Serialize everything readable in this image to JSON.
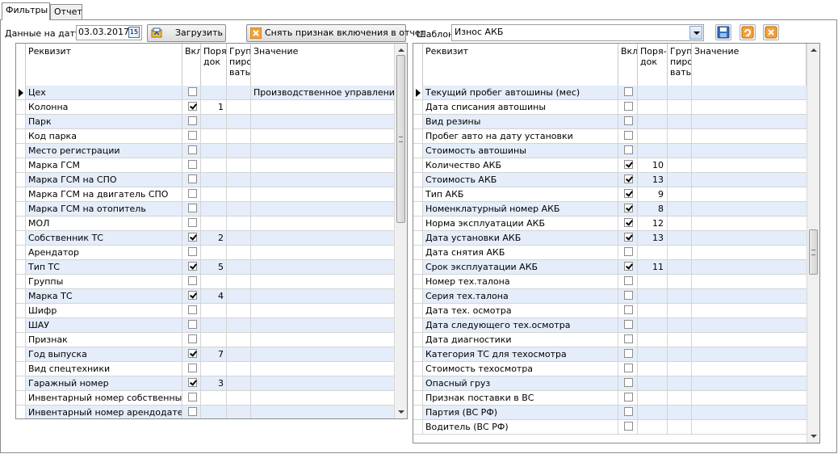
{
  "tabs": [
    {
      "label": "Фильтры",
      "active": true
    },
    {
      "label": "Отчет",
      "active": false
    }
  ],
  "toolbar": {
    "date_label": "Данные на дату:",
    "date_value": "03.03.2017",
    "load_label": "Загрузить",
    "unmark_label": "Снять признак включения в отчет",
    "template_label": "Шаблон",
    "template_value": "Износ АКБ"
  },
  "icons": {
    "calendar": "calendar-icon",
    "load": "load-icon",
    "unmark": "clear-x-icon",
    "save": "floppy-disk-icon",
    "edit": "edit-icon",
    "delete": "delete-x-icon"
  },
  "colors": {
    "row_alt": "#e4edf9",
    "accent_orange": "#f2a23a",
    "save_blue": "#2f6fc1"
  },
  "left_grid": {
    "columns": [
      "Реквизит",
      "Вкл",
      "Поря-\nдок",
      "Груп\nпиро\nвать",
      "Значение"
    ],
    "rows": [
      {
        "name": "Цех",
        "checked": false,
        "order": "",
        "value": "Производственное управление \"Т",
        "current": true
      },
      {
        "name": "Колонна",
        "checked": true,
        "order": "1",
        "value": ""
      },
      {
        "name": "Парк",
        "checked": false,
        "order": "",
        "value": ""
      },
      {
        "name": "Код парка",
        "checked": false,
        "order": "",
        "value": ""
      },
      {
        "name": "Место регистрации",
        "checked": false,
        "order": "",
        "value": ""
      },
      {
        "name": "Марка ГСМ",
        "checked": false,
        "order": "",
        "value": ""
      },
      {
        "name": "Марка ГСМ на СПО",
        "checked": false,
        "order": "",
        "value": ""
      },
      {
        "name": "Марка ГСМ на двигатель СПО",
        "checked": false,
        "order": "",
        "value": ""
      },
      {
        "name": "Марка ГСМ на отопитель",
        "checked": false,
        "order": "",
        "value": ""
      },
      {
        "name": "МОЛ",
        "checked": false,
        "order": "",
        "value": ""
      },
      {
        "name": "Собственник ТС",
        "checked": true,
        "order": "2",
        "value": ""
      },
      {
        "name": "Арендатор",
        "checked": false,
        "order": "",
        "value": ""
      },
      {
        "name": "Тип ТС",
        "checked": true,
        "order": "5",
        "value": ""
      },
      {
        "name": "Группы",
        "checked": false,
        "order": "",
        "value": ""
      },
      {
        "name": "Марка ТС",
        "checked": true,
        "order": "4",
        "value": ""
      },
      {
        "name": "Шифр",
        "checked": false,
        "order": "",
        "value": ""
      },
      {
        "name": "ШАУ",
        "checked": false,
        "order": "",
        "value": ""
      },
      {
        "name": "Признак",
        "checked": false,
        "order": "",
        "value": ""
      },
      {
        "name": "Год выпуска",
        "checked": true,
        "order": "7",
        "value": ""
      },
      {
        "name": "Вид спецтехники",
        "checked": false,
        "order": "",
        "value": ""
      },
      {
        "name": "Гаражный номер",
        "checked": true,
        "order": "3",
        "value": ""
      },
      {
        "name": "Инвентарный номер собственный",
        "checked": false,
        "order": "",
        "value": ""
      },
      {
        "name": "Инвентарный номер арендодателя",
        "checked": false,
        "order": "",
        "value": ""
      }
    ]
  },
  "right_grid": {
    "columns": [
      "Реквизит",
      "Вкл",
      "Поря-\nдок",
      "Груп\nпиро\nвать",
      "Значение"
    ],
    "rows": [
      {
        "name": "Текущий пробег автошины (мес)",
        "checked": false,
        "order": "",
        "value": "",
        "current": true
      },
      {
        "name": "Дата списания автошины",
        "checked": false,
        "order": "",
        "value": ""
      },
      {
        "name": "Вид резины",
        "checked": false,
        "order": "",
        "value": ""
      },
      {
        "name": "Пробег авто на дату установки",
        "checked": false,
        "order": "",
        "value": ""
      },
      {
        "name": "Стоимость автошины",
        "checked": false,
        "order": "",
        "value": ""
      },
      {
        "name": "Количество АКБ",
        "checked": true,
        "order": "10",
        "value": ""
      },
      {
        "name": "Стоимость АКБ",
        "checked": true,
        "order": "13",
        "value": ""
      },
      {
        "name": "Тип АКБ",
        "checked": true,
        "order": "9",
        "value": ""
      },
      {
        "name": "Номенклатурный номер АКБ",
        "checked": true,
        "order": "8",
        "value": ""
      },
      {
        "name": "Норма эксплуатации АКБ",
        "checked": true,
        "order": "12",
        "value": ""
      },
      {
        "name": "Дата установки АКБ",
        "checked": true,
        "order": "13",
        "value": ""
      },
      {
        "name": "Дата снятия АКБ",
        "checked": false,
        "order": "",
        "value": ""
      },
      {
        "name": "Срок эксплуатации АКБ",
        "checked": true,
        "order": "11",
        "value": ""
      },
      {
        "name": "Номер тех.талона",
        "checked": false,
        "order": "",
        "value": ""
      },
      {
        "name": "Серия тех.талона",
        "checked": false,
        "order": "",
        "value": ""
      },
      {
        "name": "Дата тех. осмотра",
        "checked": false,
        "order": "",
        "value": ""
      },
      {
        "name": "Дата следующего тех.осмотра",
        "checked": false,
        "order": "",
        "value": ""
      },
      {
        "name": "Дата диагностики",
        "checked": false,
        "order": "",
        "value": ""
      },
      {
        "name": "Категория ТС для техосмотра",
        "checked": false,
        "order": "",
        "value": ""
      },
      {
        "name": "Стоимость техосмотра",
        "checked": false,
        "order": "",
        "value": ""
      },
      {
        "name": "Опасный груз",
        "checked": false,
        "order": "",
        "value": ""
      },
      {
        "name": "Признак поставки в ВС",
        "checked": false,
        "order": "",
        "value": ""
      },
      {
        "name": "Партия (ВС РФ)",
        "checked": false,
        "order": "",
        "value": ""
      },
      {
        "name": "Водитель (ВС РФ)",
        "checked": false,
        "order": "",
        "value": ""
      }
    ]
  }
}
